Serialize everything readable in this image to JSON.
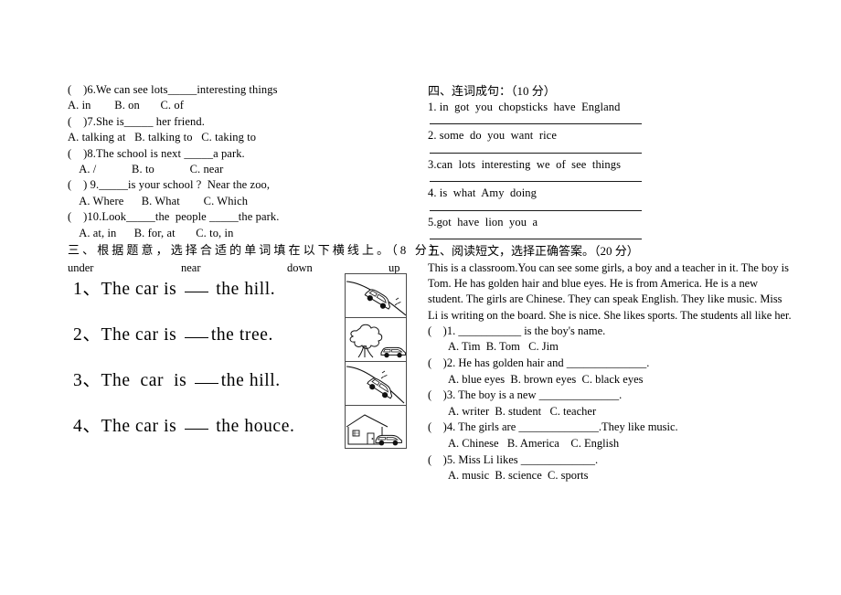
{
  "document": {
    "type": "primary-school-english-exam-paper",
    "page_background": "#ffffff",
    "text_color": "#000000"
  },
  "left_column": {
    "multiple_choice_continued": [
      {
        "question": "(    )6.We can see lots_____interesting things",
        "options": "A. in        B. on       C. of",
        "indent": false
      },
      {
        "question": "(    )7.She is_____ her friend.",
        "options": "A. talking at   B. talking to   C. taking to",
        "indent": false
      },
      {
        "question": "(    )8.The school is next _____a park.",
        "options": "    A. /            B. to            C. near",
        "indent": false
      },
      {
        "question": "(    ) 9._____is your school ?  Near the zoo,",
        "options": "    A. Where      B. What        C. Which",
        "indent": false
      },
      {
        "question": "(    )10.Look_____the  people _____the park.",
        "options": "    A. at, in      B. for, at       C. to, in",
        "indent": false
      }
    ],
    "section_three": {
      "heading": "三、根据题意，选择合适的单词填在以下横线上。（8 分）",
      "word_bank": [
        "under",
        "near",
        "down",
        "up"
      ],
      "sentences": [
        {
          "number": "1、",
          "before": "The car is ",
          "after": " the hill."
        },
        {
          "number": "2、",
          "before": "The car is ",
          "after": "the tree."
        },
        {
          "number": "3、",
          "before": "The  car  is ",
          "after": "the hill."
        },
        {
          "number": "4、",
          "before": "The car is ",
          "after": " the houce."
        }
      ],
      "pictures": [
        {
          "name": "car-up-hill",
          "alt": "car driving up a hill"
        },
        {
          "name": "car-near-tree",
          "alt": "car beside a tree"
        },
        {
          "name": "car-down-hill",
          "alt": "car driving down a hill"
        },
        {
          "name": "car-near-house",
          "alt": "car beside a house"
        }
      ]
    }
  },
  "right_column": {
    "section_four": {
      "heading": "四、连词成句：（10 分）",
      "items": [
        "1. in  got  you  chopsticks  have  England",
        "2. some  do  you  want  rice",
        "3.can  lots  interesting  we  of  see  things",
        "4. is  what  Amy  doing",
        "5.got  have  lion  you  a"
      ]
    },
    "section_five": {
      "heading": "五、阅读短文，选择正确答案。（20 分）",
      "passage_lines": [
        "This is a classroom.You can see some girls, a boy and a teacher in it. The boy is",
        "Tom. He has golden hair and blue eyes. He is from America. He is a new",
        "student. The girls are Chinese. They can speak English. They like music. Miss",
        "Li is writing on the board. She is nice. She likes sports. The students all like her."
      ],
      "questions": [
        {
          "q": "(    )1. ___________ is the boy's name.",
          "o": "A. Tim  B. Tom   C. Jim"
        },
        {
          "q": "(    )2. He has golden hair and ______________.",
          "o": "A. blue eyes  B. brown eyes  C. black eyes"
        },
        {
          "q": "(    )3. The boy is a new ______________.",
          "o": "A. writer  B. student   C. teacher"
        },
        {
          "q": "(    )4. The girls are ______________.They like music.",
          "o": "A. Chinese   B. America    C. English"
        },
        {
          "q": "(    )5. Miss Li likes _____________.",
          "o": "A. music  B. science  C. sports"
        }
      ]
    }
  }
}
